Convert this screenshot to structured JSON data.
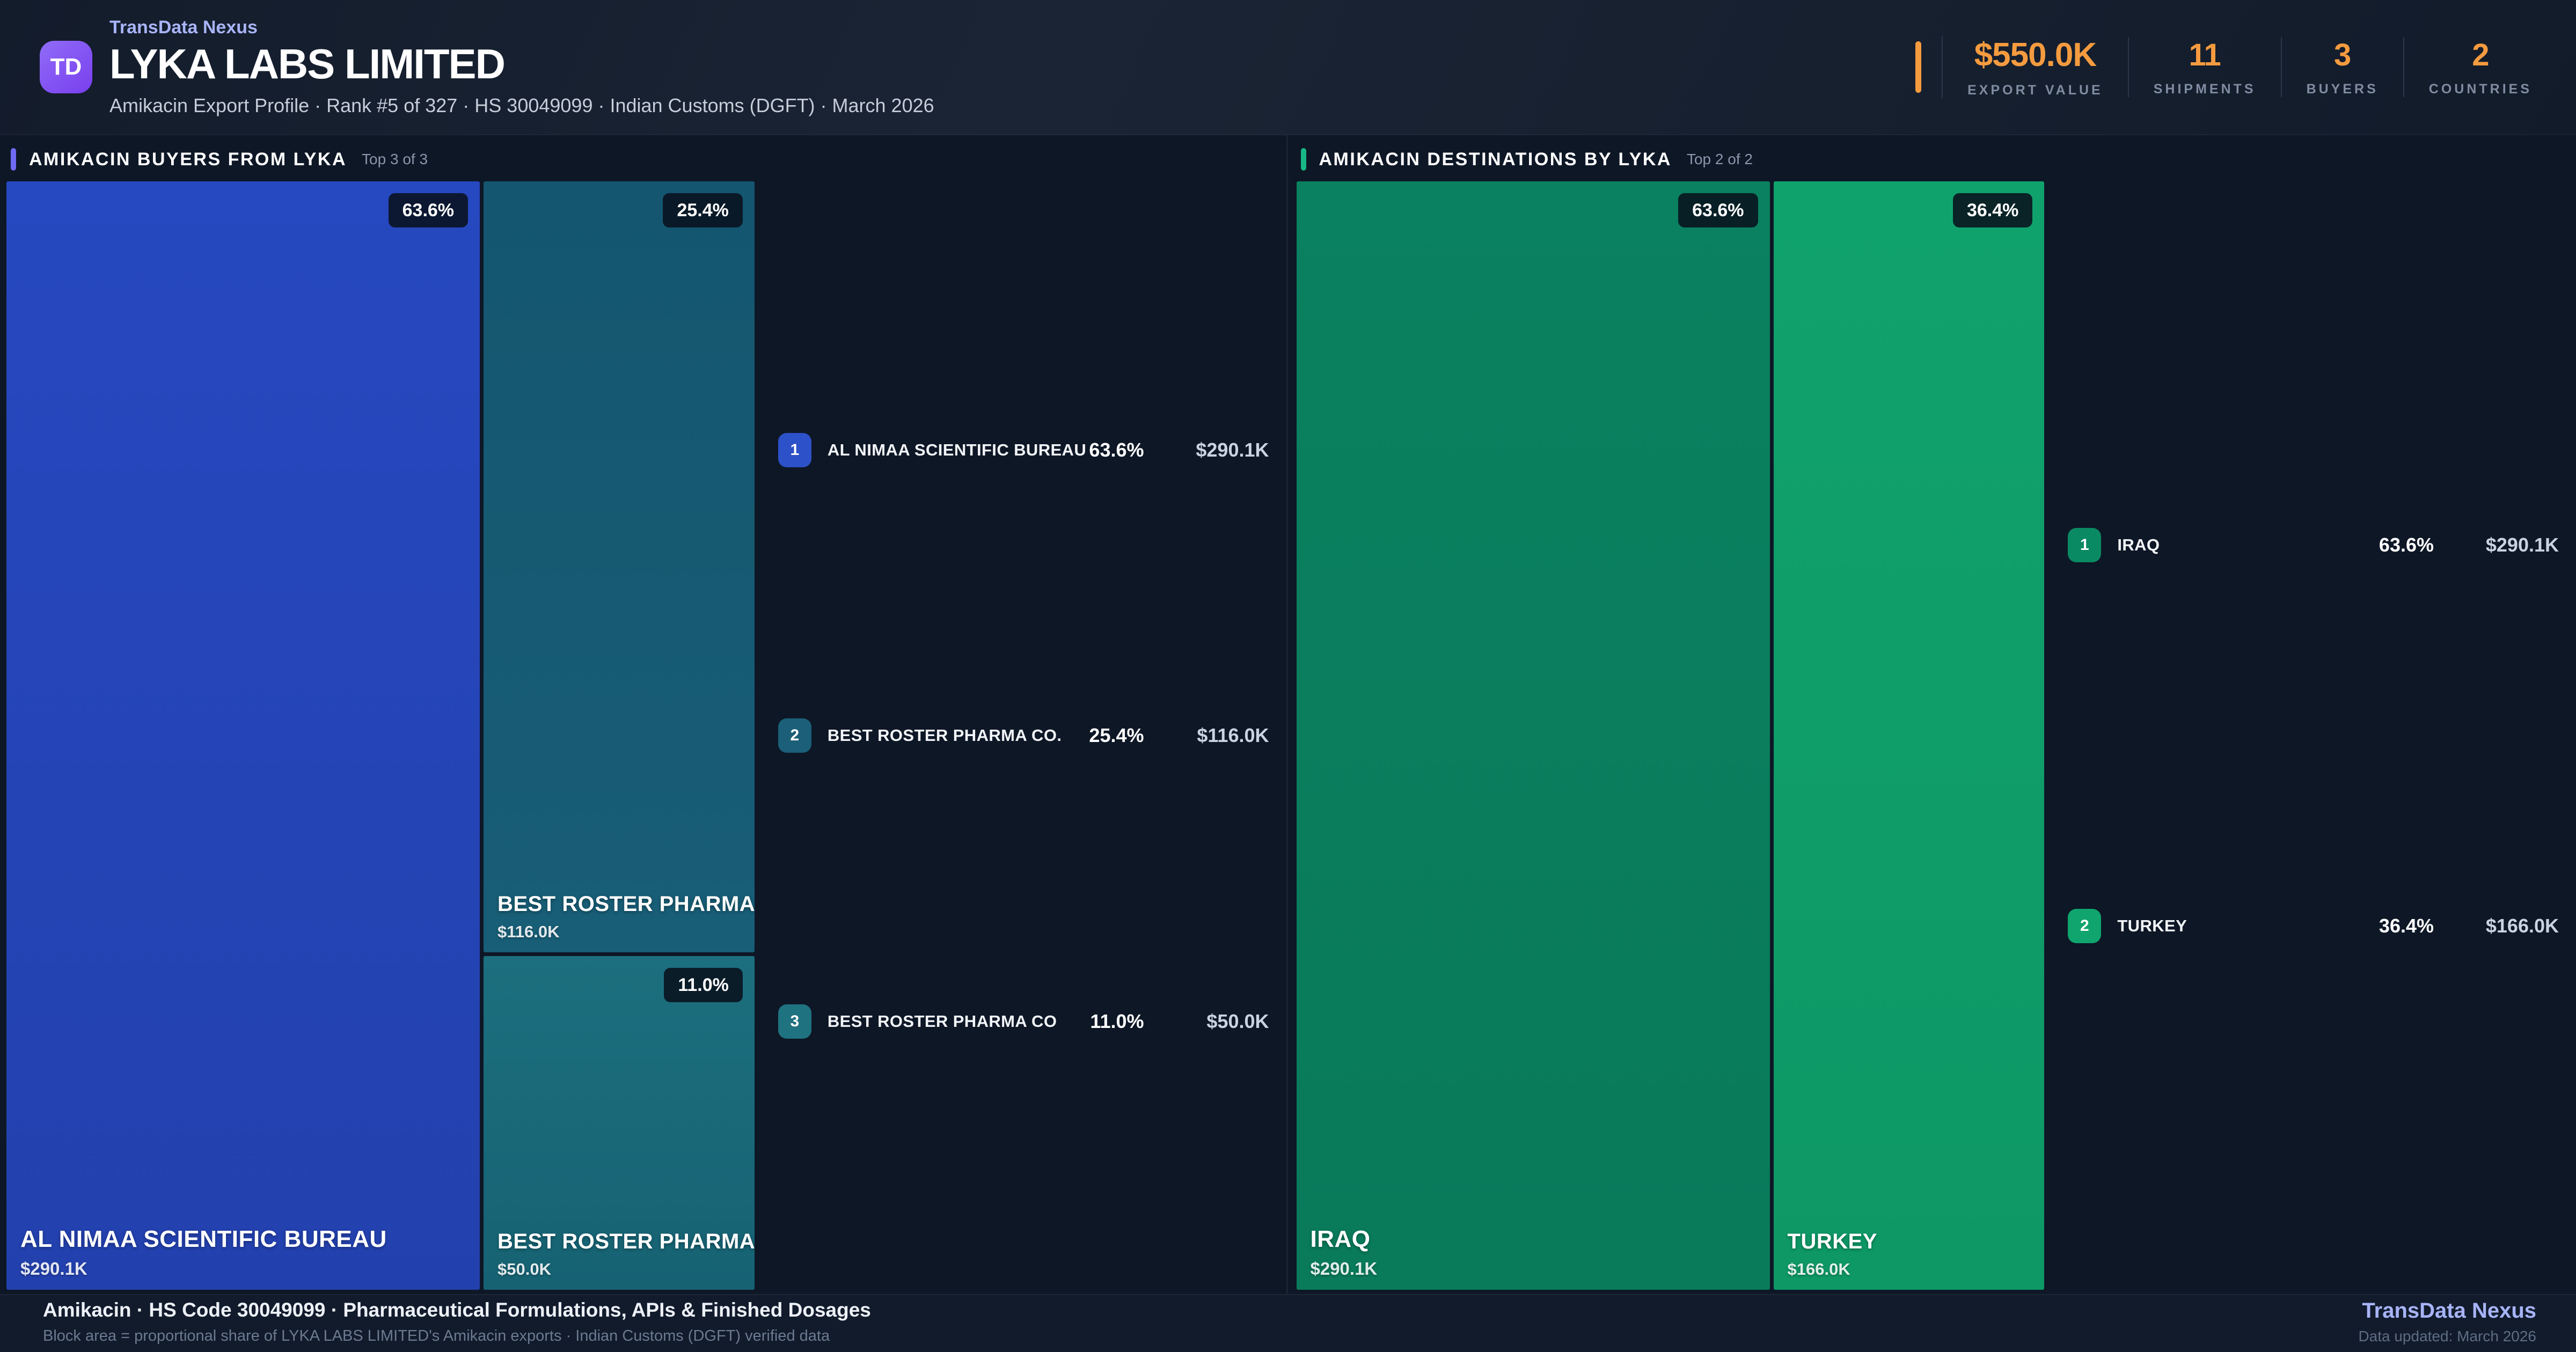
{
  "brand": {
    "logo_text": "TD",
    "name": "TransData Nexus"
  },
  "header": {
    "company": "LYKA LABS LIMITED",
    "subtitle": "Amikacin Export Profile · Rank #5 of 327 · HS 30049099 · Indian Customs (DGFT) · March 2026",
    "stats": [
      {
        "value": "$550.0K",
        "label": "EXPORT VALUE"
      },
      {
        "value": "11",
        "label": "SHIPMENTS"
      },
      {
        "value": "3",
        "label": "BUYERS"
      },
      {
        "value": "2",
        "label": "COUNTRIES"
      }
    ]
  },
  "chart_data": [
    {
      "type": "treemap",
      "title": "AMIKACIN BUYERS FROM LYKA",
      "subtitle": "Top 3 of 3",
      "note": "Block area = proportional share of total export value",
      "accent_color": "#6f6af3",
      "items": [
        {
          "rank": "1",
          "name": "AL NIMAA SCIENTIFIC BUREAU",
          "share_pct": 63.6,
          "share_label": "63.6%",
          "value_usd_k": 290.1,
          "value_label": "$290.1K",
          "color": "#2648c0"
        },
        {
          "rank": "2",
          "name": "BEST ROSTER PHARMA CO.",
          "share_pct": 25.4,
          "share_label": "25.4%",
          "value_usd_k": 116.0,
          "value_label": "$116.0K",
          "color": "#14566f"
        },
        {
          "rank": "3",
          "name": "BEST ROSTER PHARMA CO",
          "share_pct": 11.0,
          "share_label": "11.0%",
          "value_usd_k": 50.0,
          "value_label": "$50.0K",
          "color": "#1c6f7e"
        }
      ]
    },
    {
      "type": "treemap",
      "title": "AMIKACIN DESTINATIONS BY LYKA",
      "subtitle": "Top 2 of 2",
      "note": "Block area = proportional share of total export value",
      "accent_color": "#17b886",
      "items": [
        {
          "rank": "1",
          "name": "IRAQ",
          "share_pct": 63.6,
          "share_label": "63.6%",
          "value_usd_k": 290.1,
          "value_label": "$290.1K",
          "color": "#0a8160"
        },
        {
          "rank": "2",
          "name": "TURKEY",
          "share_pct": 36.4,
          "share_label": "36.4%",
          "value_usd_k": 166.0,
          "value_label": "$166.0K",
          "color": "#10a26d"
        }
      ]
    }
  ],
  "footer": {
    "line1": "Amikacin · HS Code 30049099 · Pharmaceutical Formulations, APIs & Finished Dosages",
    "line2": "Block area = proportional share of LYKA LABS LIMITED's Amikacin exports · Indian Customs (DGFT) verified data",
    "brand": "TransData Nexus",
    "updated": "Data updated: March 2026"
  },
  "colors": {
    "page_bg": "#0e1726",
    "header_bg": "#16202f",
    "accent_orange": "#f59b3f",
    "accent_indigo": "#6f6af3",
    "accent_green": "#17b886",
    "buyer_blue": "#2648c0",
    "buyer_teal": "#14566f",
    "buyer_teal_light": "#1c6f7e",
    "dest_green_dark": "#0a8160",
    "dest_green_light": "#10a26d",
    "brand_lavender": "#a8b4f7"
  }
}
